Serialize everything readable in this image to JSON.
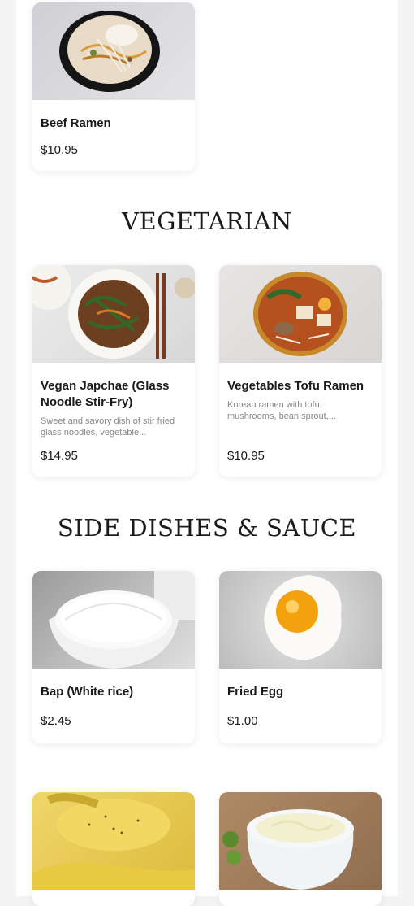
{
  "sections": [
    {
      "title": "",
      "items": [
        {
          "name": "Beef Ramen",
          "price": "$10.95",
          "image": "beef-ramen-bowl"
        }
      ]
    },
    {
      "title": "VEGETARIAN",
      "items": [
        {
          "name": "Vegan Japchae (Glass Noodle Stir-Fry)",
          "description": "Sweet and savory dish of stir fried glass noodles, vegetable...",
          "price": "$14.95",
          "image": "japchae-plate"
        },
        {
          "name": "Vegetables Tofu Ramen",
          "description": "Korean ramen with tofu, mushrooms, bean sprout,...",
          "price": "$10.95",
          "image": "tofu-ramen-bowl"
        }
      ]
    },
    {
      "title": "SIDE DISHES & SAUCE",
      "items": [
        {
          "name": "Bap (White rice)",
          "price": "$2.45",
          "image": "white-rice-bowl"
        },
        {
          "name": "Fried Egg",
          "price": "$1.00",
          "image": "fried-egg"
        },
        {
          "name": "",
          "price": "",
          "image": "mustard-sauce"
        },
        {
          "name": "",
          "price": "",
          "image": "mayo-sauce"
        }
      ]
    }
  ],
  "colors": {
    "background": "#f4f4f5",
    "card": "#ffffff",
    "text": "#1a1a1a",
    "muted": "#888888"
  }
}
